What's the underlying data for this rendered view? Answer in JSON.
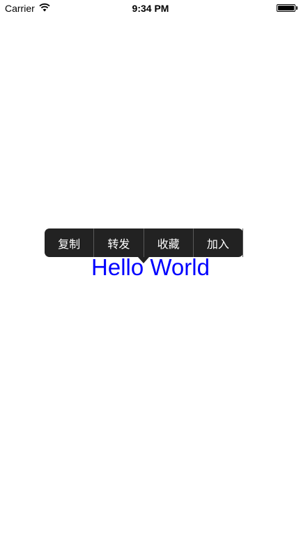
{
  "status_bar": {
    "carrier": "Carrier",
    "time": "9:34 PM",
    "wifi_icon": "wifi-icon",
    "battery_icon": "battery-icon"
  },
  "edit_menu": {
    "items": [
      {
        "label": "复制"
      },
      {
        "label": "转发"
      },
      {
        "label": "收藏"
      },
      {
        "label": "加入"
      }
    ]
  },
  "main": {
    "label": "Hello World",
    "label_color": "#0000ff"
  }
}
